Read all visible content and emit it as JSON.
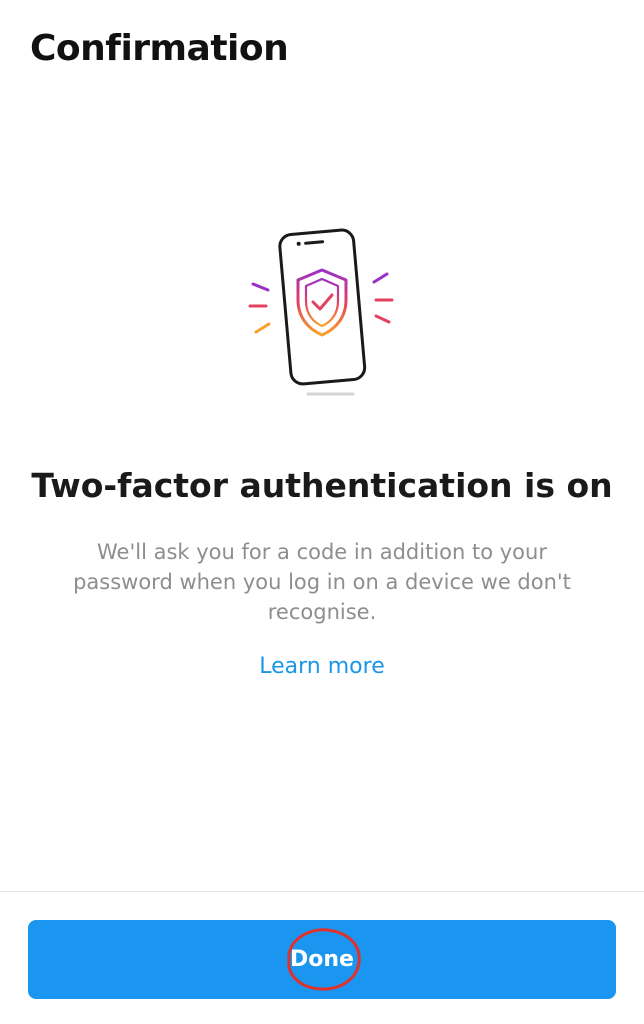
{
  "header": {
    "title": "Confirmation"
  },
  "illustration": {
    "icon": "phone-shield-check-icon"
  },
  "main": {
    "headline": "Two-factor authentication is on",
    "description": "We'll ask you for a code in addition to your password when you log in on a device we don't recognise.",
    "learn_more": "Learn more"
  },
  "footer": {
    "done_label": "Done"
  },
  "colors": {
    "primary_button": "#1a96f0",
    "link": "#1a96e6",
    "highlight_circle": "#e0322d"
  }
}
